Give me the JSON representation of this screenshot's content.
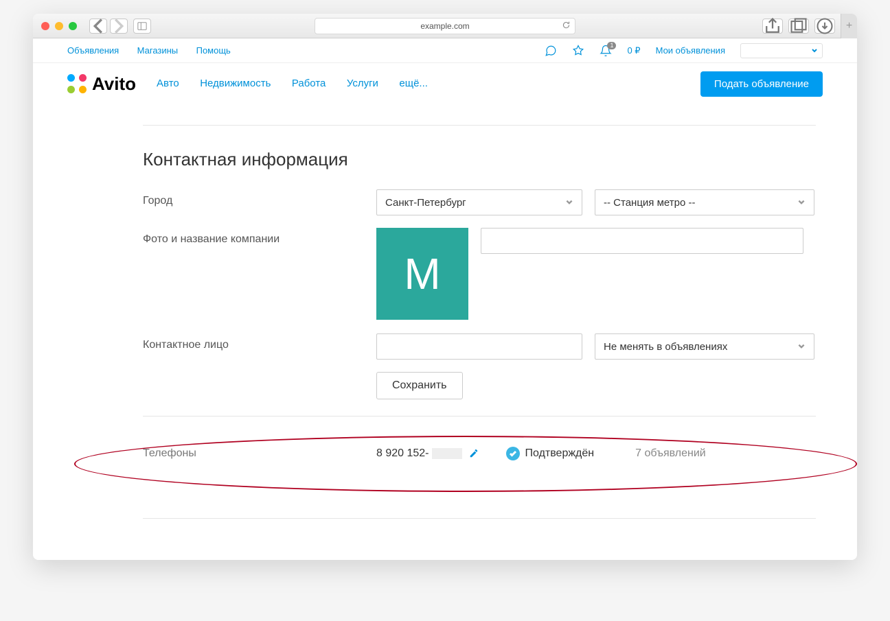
{
  "browser": {
    "url": "example.com"
  },
  "utilbar": {
    "links": [
      "Объявления",
      "Магазины",
      "Помощь"
    ],
    "balance": "0 ₽",
    "myads": "Мои объявления",
    "notif_count": "1"
  },
  "mainbar": {
    "logo": "Avito",
    "nav": [
      "Авто",
      "Недвижимость",
      "Работа",
      "Услуги",
      "ещё..."
    ],
    "cta": "Подать объявление"
  },
  "form": {
    "title": "Контактная информация",
    "city_label": "Город",
    "city_value": "Санкт-Петербург",
    "metro_placeholder": "-- Станция метро --",
    "company_label": "Фото и название компании",
    "avatar_letter": "М",
    "contact_label": "Контактное лицо",
    "contact_select": "Не менять в объявлениях",
    "save": "Сохранить"
  },
  "phones": {
    "label": "Телефоны",
    "number": "8 920 152-",
    "verified": "Подтверждён",
    "ads": "7 объявлений"
  }
}
